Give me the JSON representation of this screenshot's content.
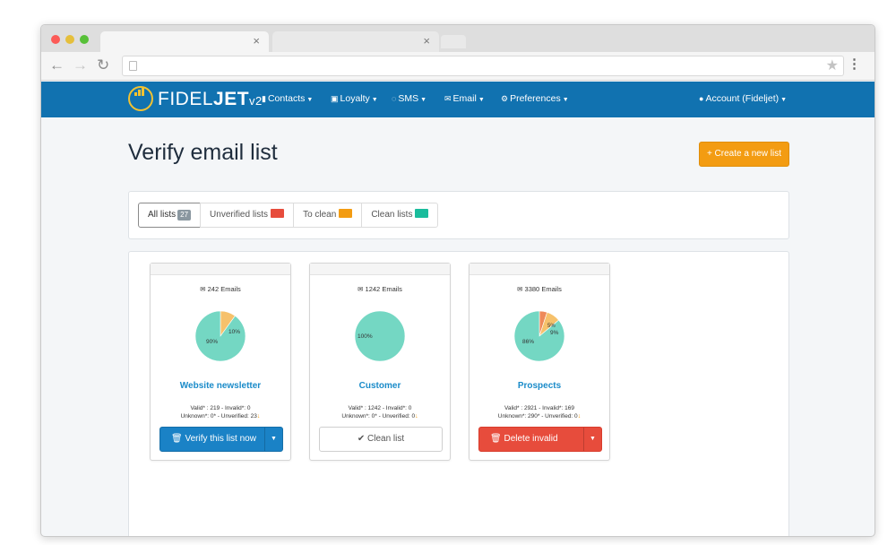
{
  "browser": {
    "tab_close": "×",
    "tab2_close": "×",
    "back_icon": "←",
    "forward_icon": "→",
    "reload_icon": "↻",
    "star_icon": "★",
    "menu_icon": "⋮"
  },
  "colors": {
    "nav_bg": "#1172b0",
    "accent_orange": "#f39c12",
    "primary_blue": "#1a82c6",
    "danger_red": "#e74c3c",
    "teal": "#1abc9c",
    "pie_valid": "#74d7c3",
    "pie_invalid": "#ee8a5a",
    "pie_unverified": "#f6c16b"
  },
  "nav": {
    "logo_light": "FIDEL",
    "logo_bold": "JET",
    "logo_version": "v2",
    "contacts": "Contacts",
    "loyalty": "Loyalty",
    "sms": "SMS",
    "email": "Email",
    "preferences": "Preferences",
    "account": "Account (Fideljet)"
  },
  "page": {
    "title": "Verify email list",
    "create_button": "+ Create a new list"
  },
  "filters": {
    "all_label": "All lists",
    "all_count": "27",
    "unverified_label": "Unverified lists",
    "to_clean_label": "To clean",
    "clean_label": "Clean lists"
  },
  "lists": [
    {
      "count": "242 Emails",
      "name": "Website newsletter",
      "stats_line1": "Valid* : 219 - Invalid*: 0",
      "stats_line2": "Unknown*: 0* - Unverified: 23",
      "button": "Verify this list now",
      "pie_labels": {
        "a": "90%",
        "b": "10%"
      },
      "pie": {
        "valid": 90,
        "invalid": 0,
        "unverified": 10
      }
    },
    {
      "count": "1242 Emails",
      "name": "Customer",
      "stats_line1": "Valid* : 1242 - Invalid*: 0",
      "stats_line2": "Unknown*: 0* - Unverified: 0",
      "button": "Clean list",
      "pie_labels": {
        "a": "100%"
      },
      "pie": {
        "valid": 100,
        "invalid": 0,
        "unverified": 0
      }
    },
    {
      "count": "3380 Emails",
      "name": "Prospects",
      "stats_line1": "Valid* : 2921 - Invalid*: 169",
      "stats_line2": "Unknown*: 290* - Unverified: 0",
      "button": "Delete invalid",
      "pie_labels": {
        "a": "86%",
        "b": "9%",
        "c": "5%"
      },
      "pie": {
        "valid": 86,
        "invalid": 5,
        "unverified": 9
      }
    }
  ]
}
